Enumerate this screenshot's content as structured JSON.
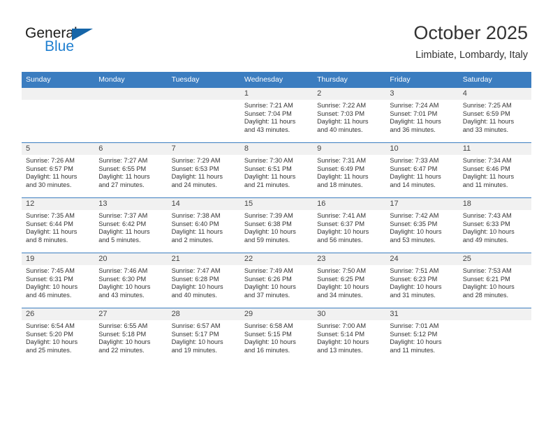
{
  "brand": {
    "name_part1": "General",
    "name_part2": "Blue",
    "accent_color": "#1f7fd0",
    "triangle_color": "#1565a8"
  },
  "header": {
    "title": "October 2025",
    "subtitle": "Limbiate, Lombardy, Italy"
  },
  "theme": {
    "header_row_color": "#3b7dc0",
    "daynum_band_color": "#f1f1f1",
    "text_color": "#333333"
  },
  "weekday_headers": [
    "Sunday",
    "Monday",
    "Tuesday",
    "Wednesday",
    "Thursday",
    "Friday",
    "Saturday"
  ],
  "labels": {
    "sunrise_prefix": "Sunrise: ",
    "sunset_prefix": "Sunset: ",
    "daylight_prefix": "Daylight: "
  },
  "weeks": [
    [
      {
        "day": "",
        "sunrise": "",
        "sunset": "",
        "daylight_line1": "",
        "daylight_line2": "",
        "empty": true
      },
      {
        "day": "",
        "sunrise": "",
        "sunset": "",
        "daylight_line1": "",
        "daylight_line2": "",
        "empty": true
      },
      {
        "day": "",
        "sunrise": "",
        "sunset": "",
        "daylight_line1": "",
        "daylight_line2": "",
        "empty": true
      },
      {
        "day": "1",
        "sunrise": "Sunrise: 7:21 AM",
        "sunset": "Sunset: 7:04 PM",
        "daylight_line1": "Daylight: 11 hours",
        "daylight_line2": "and 43 minutes.",
        "empty": false
      },
      {
        "day": "2",
        "sunrise": "Sunrise: 7:22 AM",
        "sunset": "Sunset: 7:03 PM",
        "daylight_line1": "Daylight: 11 hours",
        "daylight_line2": "and 40 minutes.",
        "empty": false
      },
      {
        "day": "3",
        "sunrise": "Sunrise: 7:24 AM",
        "sunset": "Sunset: 7:01 PM",
        "daylight_line1": "Daylight: 11 hours",
        "daylight_line2": "and 36 minutes.",
        "empty": false
      },
      {
        "day": "4",
        "sunrise": "Sunrise: 7:25 AM",
        "sunset": "Sunset: 6:59 PM",
        "daylight_line1": "Daylight: 11 hours",
        "daylight_line2": "and 33 minutes.",
        "empty": false
      }
    ],
    [
      {
        "day": "5",
        "sunrise": "Sunrise: 7:26 AM",
        "sunset": "Sunset: 6:57 PM",
        "daylight_line1": "Daylight: 11 hours",
        "daylight_line2": "and 30 minutes.",
        "empty": false
      },
      {
        "day": "6",
        "sunrise": "Sunrise: 7:27 AM",
        "sunset": "Sunset: 6:55 PM",
        "daylight_line1": "Daylight: 11 hours",
        "daylight_line2": "and 27 minutes.",
        "empty": false
      },
      {
        "day": "7",
        "sunrise": "Sunrise: 7:29 AM",
        "sunset": "Sunset: 6:53 PM",
        "daylight_line1": "Daylight: 11 hours",
        "daylight_line2": "and 24 minutes.",
        "empty": false
      },
      {
        "day": "8",
        "sunrise": "Sunrise: 7:30 AM",
        "sunset": "Sunset: 6:51 PM",
        "daylight_line1": "Daylight: 11 hours",
        "daylight_line2": "and 21 minutes.",
        "empty": false
      },
      {
        "day": "9",
        "sunrise": "Sunrise: 7:31 AM",
        "sunset": "Sunset: 6:49 PM",
        "daylight_line1": "Daylight: 11 hours",
        "daylight_line2": "and 18 minutes.",
        "empty": false
      },
      {
        "day": "10",
        "sunrise": "Sunrise: 7:33 AM",
        "sunset": "Sunset: 6:47 PM",
        "daylight_line1": "Daylight: 11 hours",
        "daylight_line2": "and 14 minutes.",
        "empty": false
      },
      {
        "day": "11",
        "sunrise": "Sunrise: 7:34 AM",
        "sunset": "Sunset: 6:46 PM",
        "daylight_line1": "Daylight: 11 hours",
        "daylight_line2": "and 11 minutes.",
        "empty": false
      }
    ],
    [
      {
        "day": "12",
        "sunrise": "Sunrise: 7:35 AM",
        "sunset": "Sunset: 6:44 PM",
        "daylight_line1": "Daylight: 11 hours",
        "daylight_line2": "and 8 minutes.",
        "empty": false
      },
      {
        "day": "13",
        "sunrise": "Sunrise: 7:37 AM",
        "sunset": "Sunset: 6:42 PM",
        "daylight_line1": "Daylight: 11 hours",
        "daylight_line2": "and 5 minutes.",
        "empty": false
      },
      {
        "day": "14",
        "sunrise": "Sunrise: 7:38 AM",
        "sunset": "Sunset: 6:40 PM",
        "daylight_line1": "Daylight: 11 hours",
        "daylight_line2": "and 2 minutes.",
        "empty": false
      },
      {
        "day": "15",
        "sunrise": "Sunrise: 7:39 AM",
        "sunset": "Sunset: 6:38 PM",
        "daylight_line1": "Daylight: 10 hours",
        "daylight_line2": "and 59 minutes.",
        "empty": false
      },
      {
        "day": "16",
        "sunrise": "Sunrise: 7:41 AM",
        "sunset": "Sunset: 6:37 PM",
        "daylight_line1": "Daylight: 10 hours",
        "daylight_line2": "and 56 minutes.",
        "empty": false
      },
      {
        "day": "17",
        "sunrise": "Sunrise: 7:42 AM",
        "sunset": "Sunset: 6:35 PM",
        "daylight_line1": "Daylight: 10 hours",
        "daylight_line2": "and 53 minutes.",
        "empty": false
      },
      {
        "day": "18",
        "sunrise": "Sunrise: 7:43 AM",
        "sunset": "Sunset: 6:33 PM",
        "daylight_line1": "Daylight: 10 hours",
        "daylight_line2": "and 49 minutes.",
        "empty": false
      }
    ],
    [
      {
        "day": "19",
        "sunrise": "Sunrise: 7:45 AM",
        "sunset": "Sunset: 6:31 PM",
        "daylight_line1": "Daylight: 10 hours",
        "daylight_line2": "and 46 minutes.",
        "empty": false
      },
      {
        "day": "20",
        "sunrise": "Sunrise: 7:46 AM",
        "sunset": "Sunset: 6:30 PM",
        "daylight_line1": "Daylight: 10 hours",
        "daylight_line2": "and 43 minutes.",
        "empty": false
      },
      {
        "day": "21",
        "sunrise": "Sunrise: 7:47 AM",
        "sunset": "Sunset: 6:28 PM",
        "daylight_line1": "Daylight: 10 hours",
        "daylight_line2": "and 40 minutes.",
        "empty": false
      },
      {
        "day": "22",
        "sunrise": "Sunrise: 7:49 AM",
        "sunset": "Sunset: 6:26 PM",
        "daylight_line1": "Daylight: 10 hours",
        "daylight_line2": "and 37 minutes.",
        "empty": false
      },
      {
        "day": "23",
        "sunrise": "Sunrise: 7:50 AM",
        "sunset": "Sunset: 6:25 PM",
        "daylight_line1": "Daylight: 10 hours",
        "daylight_line2": "and 34 minutes.",
        "empty": false
      },
      {
        "day": "24",
        "sunrise": "Sunrise: 7:51 AM",
        "sunset": "Sunset: 6:23 PM",
        "daylight_line1": "Daylight: 10 hours",
        "daylight_line2": "and 31 minutes.",
        "empty": false
      },
      {
        "day": "25",
        "sunrise": "Sunrise: 7:53 AM",
        "sunset": "Sunset: 6:21 PM",
        "daylight_line1": "Daylight: 10 hours",
        "daylight_line2": "and 28 minutes.",
        "empty": false
      }
    ],
    [
      {
        "day": "26",
        "sunrise": "Sunrise: 6:54 AM",
        "sunset": "Sunset: 5:20 PM",
        "daylight_line1": "Daylight: 10 hours",
        "daylight_line2": "and 25 minutes.",
        "empty": false
      },
      {
        "day": "27",
        "sunrise": "Sunrise: 6:55 AM",
        "sunset": "Sunset: 5:18 PM",
        "daylight_line1": "Daylight: 10 hours",
        "daylight_line2": "and 22 minutes.",
        "empty": false
      },
      {
        "day": "28",
        "sunrise": "Sunrise: 6:57 AM",
        "sunset": "Sunset: 5:17 PM",
        "daylight_line1": "Daylight: 10 hours",
        "daylight_line2": "and 19 minutes.",
        "empty": false
      },
      {
        "day": "29",
        "sunrise": "Sunrise: 6:58 AM",
        "sunset": "Sunset: 5:15 PM",
        "daylight_line1": "Daylight: 10 hours",
        "daylight_line2": "and 16 minutes.",
        "empty": false
      },
      {
        "day": "30",
        "sunrise": "Sunrise: 7:00 AM",
        "sunset": "Sunset: 5:14 PM",
        "daylight_line1": "Daylight: 10 hours",
        "daylight_line2": "and 13 minutes.",
        "empty": false
      },
      {
        "day": "31",
        "sunrise": "Sunrise: 7:01 AM",
        "sunset": "Sunset: 5:12 PM",
        "daylight_line1": "Daylight: 10 hours",
        "daylight_line2": "and 11 minutes.",
        "empty": false
      },
      {
        "day": "",
        "sunrise": "",
        "sunset": "",
        "daylight_line1": "",
        "daylight_line2": "",
        "empty": true
      }
    ]
  ]
}
